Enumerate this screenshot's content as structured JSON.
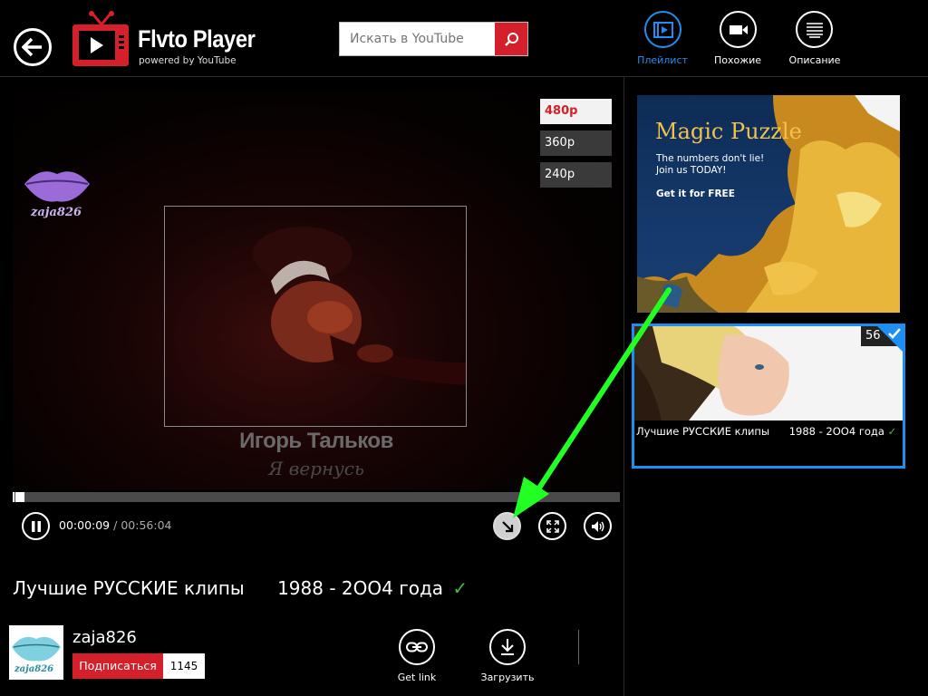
{
  "header": {
    "app_title": "Flvto Player",
    "app_subtitle": "powered by YouTube",
    "search_placeholder": "Искать в YouTube",
    "tabs": [
      {
        "label": "Плейлист",
        "active": true,
        "icon": "playlist-icon"
      },
      {
        "label": "Похожие",
        "active": false,
        "icon": "video-camera-icon"
      },
      {
        "label": "Описание",
        "active": false,
        "icon": "description-icon"
      }
    ]
  },
  "player": {
    "qualities": [
      "480p",
      "360p",
      "240p"
    ],
    "selected_quality": "480p",
    "watermark_text": "zaja826",
    "overlay_title": "Игорь Тальков",
    "overlay_subtitle": "Я вернусь",
    "current_time": "00:00:09",
    "time_separator": "/",
    "duration": "00:56:04",
    "progress_fraction": 0.003
  },
  "video": {
    "title": "Лучшие РУССКИЕ клипы",
    "years": "1988 - 2OO4 года",
    "check": "✓"
  },
  "channel": {
    "name": "zaja826",
    "avatar_text": "zaja826",
    "subscribe_label": "Подписаться",
    "subscriber_count": "1145"
  },
  "actions": {
    "get_link_label": "Get link",
    "download_label": "Загрузить"
  },
  "sidebar": {
    "ad": {
      "title": "Magic Puzzle",
      "line1": "The numbers don't lie!",
      "line2": "Join us TODAY!",
      "cta": "Get it for FREE"
    },
    "playlist_item": {
      "badge": "56",
      "title": "Лучшие РУССКИЕ клипы",
      "years": "1988 - 2OO4 года",
      "check": "✓"
    }
  },
  "colors": {
    "accent_red": "#d3202a",
    "accent_blue": "#1e8ff2",
    "check_green": "#3fbf3f",
    "arrow_green": "#22ff22"
  }
}
